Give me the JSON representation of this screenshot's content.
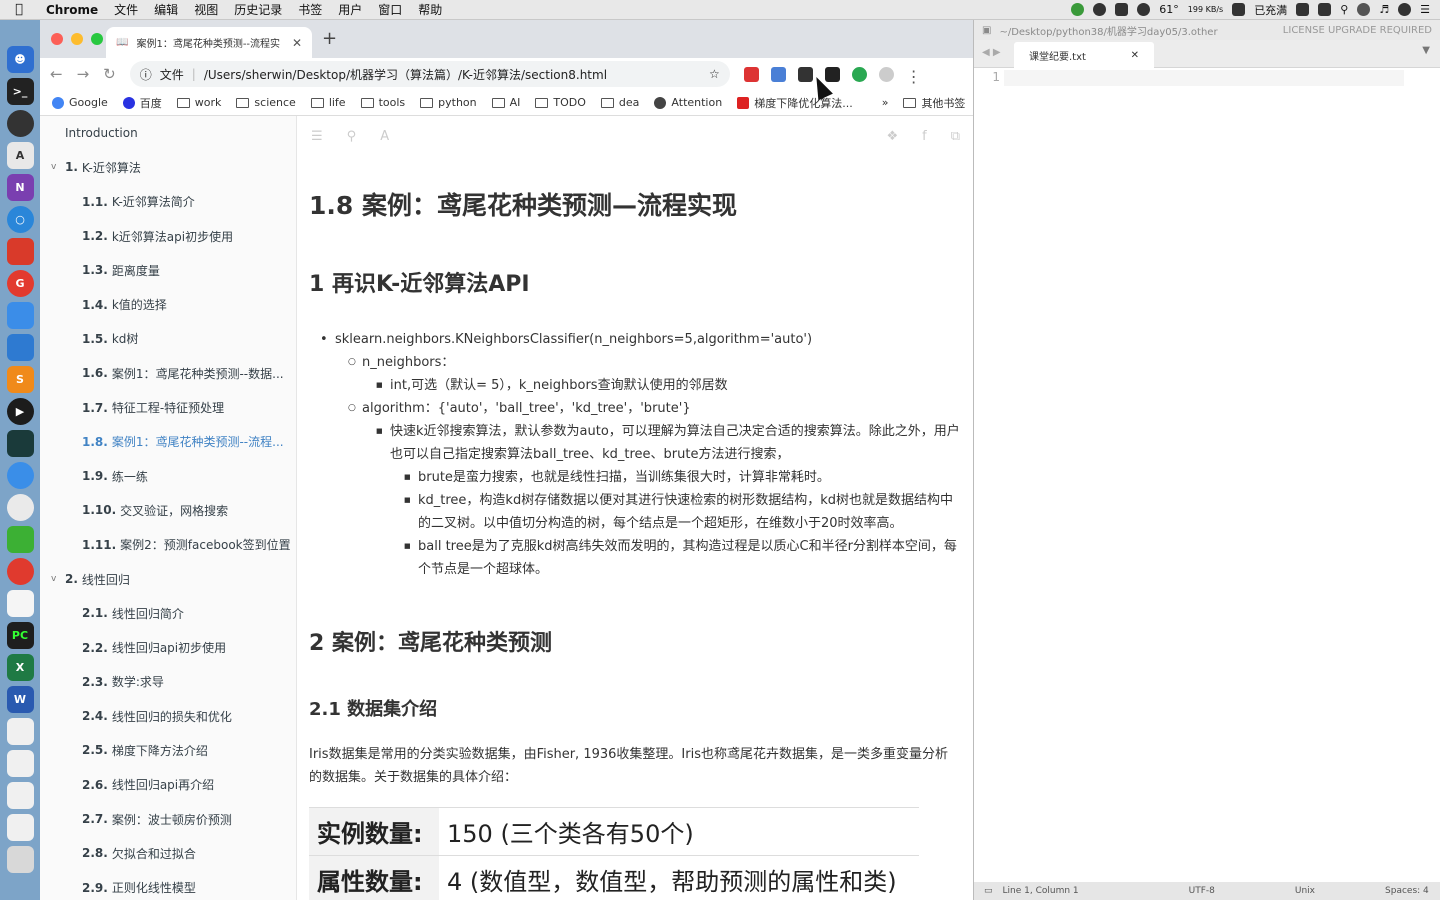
{
  "menubar": {
    "app": "Chrome",
    "items": [
      "文件",
      "编辑",
      "视图",
      "历史记录",
      "书签",
      "用户",
      "窗口",
      "帮助"
    ],
    "status": {
      "temp": "61°",
      "net": "199 KB/s",
      "battery": "已充满"
    }
  },
  "browser": {
    "tab_title": "案例1：鸢尾花种类预测--流程实",
    "omnibox_label": "文件",
    "url": "/Users/sherwin/Desktop/机器学习（算法篇）/K-近邻算法/section8.html",
    "bookmarks": [
      "Google",
      "百度",
      "work",
      "science",
      "life",
      "tools",
      "python",
      "AI",
      "TODO",
      "dea",
      "Attention",
      "梯度下降优化算法..."
    ],
    "bookmarks_more": "»",
    "other_bookmarks": "其他书签"
  },
  "sidebar": {
    "items": [
      {
        "num": "",
        "text": "Introduction",
        "level": 0
      },
      {
        "num": "1.",
        "text": "K-近邻算法",
        "level": 1
      },
      {
        "num": "1.1.",
        "text": "K-近邻算法简介",
        "level": 2
      },
      {
        "num": "1.2.",
        "text": "k近邻算法api初步使用",
        "level": 2
      },
      {
        "num": "1.3.",
        "text": "距离度量",
        "level": 2
      },
      {
        "num": "1.4.",
        "text": "k值的选择",
        "level": 2
      },
      {
        "num": "1.5.",
        "text": "kd树",
        "level": 2
      },
      {
        "num": "1.6.",
        "text": "案例1：鸢尾花种类预测--数据...",
        "level": 2
      },
      {
        "num": "1.7.",
        "text": "特征工程-特征预处理",
        "level": 2
      },
      {
        "num": "1.8.",
        "text": "案例1：鸢尾花种类预测--流程...",
        "level": 2
      },
      {
        "num": "1.9.",
        "text": "练一练",
        "level": 2
      },
      {
        "num": "1.10.",
        "text": "交叉验证，网格搜索",
        "level": 2
      },
      {
        "num": "1.11.",
        "text": "案例2：预测facebook签到位置",
        "level": 2
      },
      {
        "num": "2.",
        "text": "线性回归",
        "level": 1
      },
      {
        "num": "2.1.",
        "text": "线性回归简介",
        "level": 2
      },
      {
        "num": "2.2.",
        "text": "线性回归api初步使用",
        "level": 2
      },
      {
        "num": "2.3.",
        "text": "数学:求导",
        "level": 2
      },
      {
        "num": "2.4.",
        "text": "线性回归的损失和优化",
        "level": 2
      },
      {
        "num": "2.5.",
        "text": "梯度下降方法介绍",
        "level": 2
      },
      {
        "num": "2.6.",
        "text": "线性回归api再介绍",
        "level": 2
      },
      {
        "num": "2.7.",
        "text": "案例：波士顿房价预测",
        "level": 2
      },
      {
        "num": "2.8.",
        "text": "欠拟合和过拟合",
        "level": 2
      },
      {
        "num": "2.9.",
        "text": "正则化线性模型",
        "level": 2
      }
    ]
  },
  "article": {
    "h1": "1.8 案例：鸢尾花种类预测—流程实现",
    "h2_1": "1 再识K-近邻算法API",
    "api_sig": "sklearn.neighbors.KNeighborsClassifier(n_neighbors=5,algorithm='auto')",
    "param1": "n_neighbors：",
    "param1_desc": "int,可选（默认= 5），k_neighbors查询默认使用的邻居数",
    "param2": "algorithm：{'auto'，'ball_tree'，'kd_tree'，'brute'}",
    "param2_desc": "快速k近邻搜索算法，默认参数为auto，可以理解为算法自己决定合适的搜索算法。除此之外，用户也可以自己指定搜索算法ball_tree、kd_tree、brute方法进行搜索，",
    "brute": "brute是蛮力搜索，也就是线性扫描，当训练集很大时，计算非常耗时。",
    "kd_tree": "kd_tree，构造kd树存储数据以便对其进行快速检索的树形数据结构，kd树也就是数据结构中的二叉树。以中值切分构造的树，每个结点是一个超矩形，在维数小于20时效率高。",
    "ball_tree": "ball tree是为了克服kd树高纬失效而发明的，其构造过程是以质心C和半径r分割样本空间，每个节点是一个超球体。",
    "h2_2": "2 案例：鸢尾花种类预测",
    "h3_1": "2.1 数据集介绍",
    "p_iris": "Iris数据集是常用的分类实验数据集，由Fisher, 1936收集整理。Iris也称鸢尾花卉数据集，是一类多重变量分析的数据集。关于数据集的具体介绍：",
    "table": [
      {
        "k": "实例数量:",
        "v": "150 (三个类各有50个)"
      },
      {
        "k": "属性数量:",
        "v": "4 (数值型，数值型，帮助预测的属性和类)"
      }
    ]
  },
  "sublime": {
    "path": "~/Desktop/python38/机器学习day05/3.other",
    "license": "LICENSE UPGRADE REQUIRED",
    "tab": "课堂纪要.txt",
    "line_no": "1",
    "status_pos": "Line 1, Column 1",
    "encoding": "UTF-8",
    "line_endings": "Unix",
    "spaces": "Spaces: 4"
  }
}
